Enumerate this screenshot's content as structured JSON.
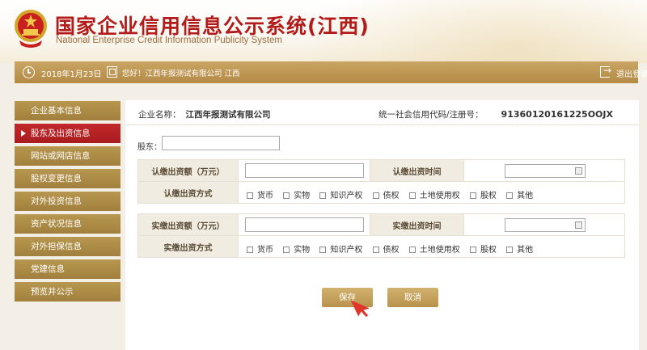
{
  "header": {
    "title": "国家企业信用信息公示系统(江西)",
    "subtitle": "National Enterprise Credit Information Publicity System",
    "emblem_icon": "national-emblem-icon"
  },
  "info_bar": {
    "date": "2018年1月23日",
    "greeting": "您好！江西年报测试有限公司  江西",
    "logout_label": "退出登录"
  },
  "sidebar": {
    "items": [
      {
        "label": "企业基本信息",
        "active": false
      },
      {
        "label": "股东及出资信息",
        "active": true
      },
      {
        "label": "网站或网店信息",
        "active": false
      },
      {
        "label": "股权变更信息",
        "active": false
      },
      {
        "label": "对外投资信息",
        "active": false
      },
      {
        "label": "资产状况信息",
        "active": false
      },
      {
        "label": "对外担保信息",
        "active": false
      },
      {
        "label": "党建信息",
        "active": false
      },
      {
        "label": "预览并公示",
        "active": false
      }
    ]
  },
  "company": {
    "name_label": "企业名称：",
    "name_value": "江西年报测试有限公司",
    "code_label": "统一社会信用代码/注册号：",
    "code_value": "91360120161225OOJX"
  },
  "shareholder": {
    "label": "股东：",
    "value": ""
  },
  "subscribed": {
    "amount_label": "认缴出资额（万元）",
    "amount_value": "",
    "time_label": "认缴出资时间",
    "time_value": "",
    "method_label": "认缴出资方式"
  },
  "paid": {
    "amount_label": "实缴出资额（万元）",
    "amount_value": "",
    "time_label": "实缴出资时间",
    "time_value": "",
    "method_label": "实缴出资方式"
  },
  "methods": [
    "货币",
    "实物",
    "知识产权",
    "债权",
    "土地使用权",
    "股权",
    "其他"
  ],
  "buttons": {
    "save": "保存",
    "cancel": "取消"
  },
  "colors": {
    "brand_red": "#b31b1b",
    "gold": "#b48a45",
    "active_tab": "#c2282a",
    "pointer": "#e0352b"
  }
}
